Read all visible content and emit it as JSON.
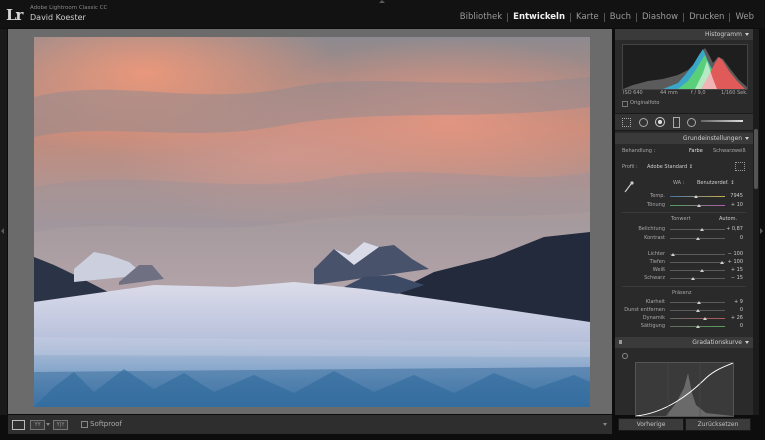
{
  "app": {
    "logo": "Lr",
    "name": "Adobe Lightroom Classic CC",
    "user": "David Koester"
  },
  "modules": [
    {
      "label": "Bibliothek",
      "active": false
    },
    {
      "label": "Entwickeln",
      "active": true
    },
    {
      "label": "Karte",
      "active": false
    },
    {
      "label": "Buch",
      "active": false
    },
    {
      "label": "Diashow",
      "active": false
    },
    {
      "label": "Drucken",
      "active": false
    },
    {
      "label": "Web",
      "active": false
    }
  ],
  "histogram": {
    "title": "Histogramm",
    "iso": "ISO 640",
    "focal": "44 mm",
    "aperture": "f / 9,0",
    "shutter": "1/160 Sek.",
    "original_photo": "Originalfoto"
  },
  "basic": {
    "title": "Grundeinstellungen",
    "treatment_label": "Behandlung :",
    "treatment_color": "Farbe",
    "treatment_bw": "Schwarzweiß",
    "profile_label": "Profil :",
    "profile_value": "Adobe Standard ↕",
    "wb_label": "WA :",
    "wb_value": "Benutzerdef. ↕",
    "temp_label": "Temp.",
    "temp_value": "7945",
    "tint_label": "Tönung",
    "tint_value": "+ 10",
    "tone_label": "Tonwert",
    "tone_auto": "Autom.",
    "exposure_label": "Belichtung",
    "exposure_value": "+ 0,87",
    "contrast_label": "Kontrast",
    "contrast_value": "0",
    "highlights_label": "Lichter",
    "highlights_value": "− 100",
    "shadows_label": "Tiefen",
    "shadows_value": "+ 100",
    "whites_label": "Weiß",
    "whites_value": "+ 15",
    "blacks_label": "Schwarz",
    "blacks_value": "− 15",
    "presence_label": "Präsenz",
    "clarity_label": "Klarheit",
    "clarity_value": "+ 9",
    "dehaze_label": "Dunst entfernen",
    "dehaze_value": "0",
    "vibrance_label": "Dynamik",
    "vibrance_value": "+ 26",
    "saturation_label": "Sättigung",
    "saturation_value": "0"
  },
  "sliders": {
    "temp": 0.48,
    "tint": 0.52,
    "exposure": 0.58,
    "contrast": 0.5,
    "highlights": 0.05,
    "shadows": 0.95,
    "whites": 0.58,
    "blacks": 0.42,
    "clarity": 0.53,
    "dehaze": 0.5,
    "vibrance": 0.63,
    "saturation": 0.5
  },
  "tone_curve": {
    "title": "Gradationskurve"
  },
  "footer": {
    "previous": "Vorherige",
    "reset": "Zurücksetzen",
    "softproof": "Softproof"
  },
  "colors": {
    "panel_bg": "#2a2a2a",
    "canvas_bg": "#6b6b6b",
    "accent": "#f0f0f0"
  }
}
